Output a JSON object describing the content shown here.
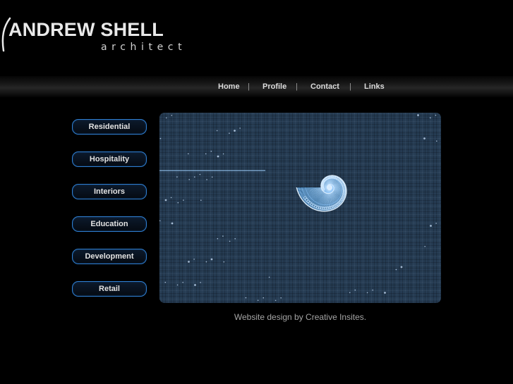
{
  "brand": {
    "name": "ANDREW SHELL",
    "subtitle": "architect"
  },
  "nav": {
    "items": [
      {
        "label": "Home"
      },
      {
        "label": "Profile"
      },
      {
        "label": "Contact"
      },
      {
        "label": "Links"
      }
    ],
    "separator": "|"
  },
  "sidebar": {
    "items": [
      {
        "label": "Residential"
      },
      {
        "label": "Hospitality"
      },
      {
        "label": "Interiors"
      },
      {
        "label": "Education"
      },
      {
        "label": "Development"
      },
      {
        "label": "Retail"
      }
    ]
  },
  "hero": {
    "icon": "nautilus-spiral-graphic"
  },
  "footer": {
    "credit": "Website design by Creative Insites."
  },
  "colors": {
    "accent": "#2f7fd2",
    "background": "#000000",
    "hero_bg": "#253b52"
  }
}
